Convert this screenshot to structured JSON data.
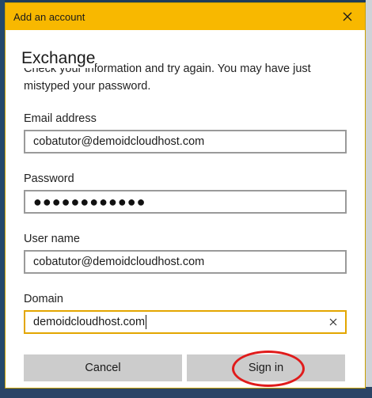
{
  "dialog": {
    "title": "Add an account",
    "heading": "Exchange",
    "info_text": "Check your information and try again. You may have just mistyped your password."
  },
  "fields": {
    "email": {
      "label": "Email address",
      "value": "cobatutor@demoidcloudhost.com"
    },
    "password": {
      "label": "Password",
      "value": "●●●●●●●●●●●●"
    },
    "username": {
      "label": "User name",
      "value": "cobatutor@demoidcloudhost.com"
    },
    "domain": {
      "label": "Domain",
      "value": "demoidcloudhost.com"
    }
  },
  "buttons": {
    "cancel": "Cancel",
    "sign_in": "Sign in"
  },
  "colors": {
    "titlebar": "#f8b800",
    "focus_border": "#e3a600",
    "highlight": "#e01b1b"
  },
  "icons": {
    "close": "close-icon",
    "clear": "clear-text-icon"
  }
}
